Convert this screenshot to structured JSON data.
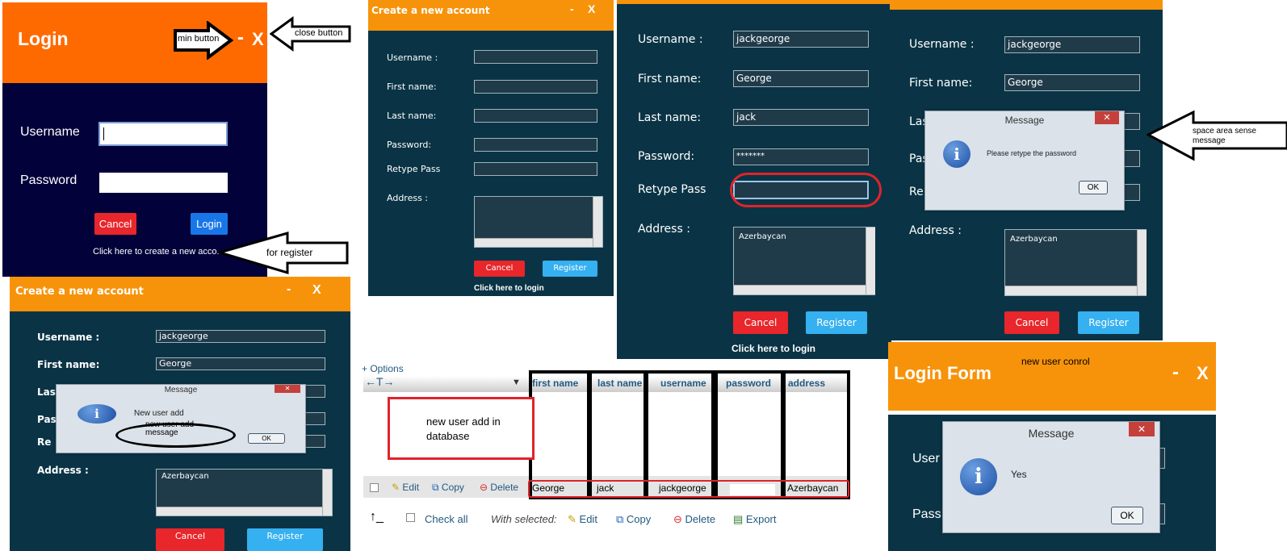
{
  "login": {
    "title": "Login",
    "min_glyph": "-",
    "close_glyph": "X",
    "username_label": "Username",
    "password_label": "Password",
    "cancel_label": "Cancel",
    "login_label": "Login",
    "register_link": "Click here to create  a new acco...",
    "annotation_min": "min button",
    "annotation_close": "close button",
    "annotation_register": "for register",
    "colors": {
      "header": "#ff6a00",
      "body": "#03013a",
      "cancel": "#e8262b",
      "login": "#1877e8"
    }
  },
  "register_empty": {
    "title": "Create a new account",
    "min_glyph": "-",
    "close_glyph": "X",
    "labels": [
      "Username :",
      "First name:",
      "Last name:",
      "Password:",
      "Retype Pass",
      "Address :"
    ],
    "cancel_label": "Cancel",
    "register_label": "Register",
    "login_link": "Click here to login"
  },
  "register_filled": {
    "labels": [
      "Username :",
      "First name:",
      "Last name:",
      "Password:",
      "Retype Pass",
      "Address :"
    ],
    "username": "jackgeorge",
    "first_name": "George",
    "last_name": "jack",
    "password": "*******",
    "retype": "",
    "address": "Azerbaycan",
    "cancel_label": "Cancel",
    "register_label": "Register",
    "login_link": "Click here to login"
  },
  "register_retype_msg": {
    "labels": [
      "Username :",
      "First name:",
      "Address :"
    ],
    "username": "jackgeorge",
    "first_name": "George",
    "address": "Azerbaycan",
    "cancel_label": "Cancel",
    "register_label": "Register",
    "dialog_title": "Message",
    "dialog_text": "Please retype the password",
    "dialog_ok": "OK",
    "annotation": "space area sense message"
  },
  "register_added_msg": {
    "title": "Create a new account",
    "min_glyph": "-",
    "close_glyph": "X",
    "labels": [
      "Username :",
      "First name:",
      "Address :"
    ],
    "username": "jackgeorge",
    "first_name": "George",
    "address": "Azerbaycan",
    "cancel_label": "Cancel",
    "register_label": "Register",
    "dialog_title": "Message",
    "dialog_text": "New user add",
    "dialog_ok": "OK",
    "annotation": "new user add message"
  },
  "database": {
    "options": "+ Options",
    "columns": [
      "first name",
      "last name",
      "username",
      "password",
      "address"
    ],
    "row": [
      "George",
      "jack",
      "jackgeorge",
      "",
      "Azerbaycan"
    ],
    "row_edit": "Edit",
    "row_copy": "Copy",
    "row_delete": "Delete",
    "check_all": "Check all",
    "with_selected": "With selected:",
    "edit": "Edit",
    "copy": "Copy",
    "delete": "Delete",
    "export": "Export",
    "annotation": "new user  add in database"
  },
  "login_form": {
    "annotation": "new user conrol",
    "title": "Login Form",
    "min_glyph": "-",
    "close_glyph": "X",
    "username_partial": "User",
    "password_partial": "Pass",
    "dialog_title": "Message",
    "dialog_text": "Yes",
    "dialog_ok": "OK"
  }
}
